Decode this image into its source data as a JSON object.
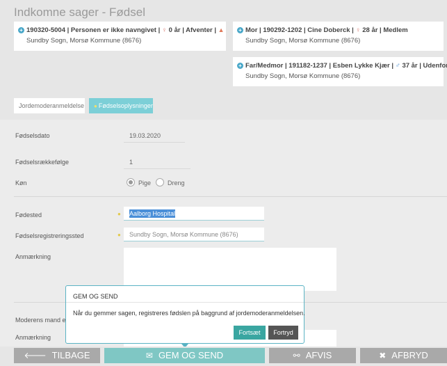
{
  "page_title": "Indkomne sager - Fødsel",
  "cards": {
    "child": {
      "line1": "190320-5004 | Personen er ikke navngivet | ",
      "age": "0 år",
      "status": " | Afventer | ",
      "location": "Sundby Sogn, Morsø Kommune (8676)"
    },
    "mother": {
      "line1": "Mor | 190292-1202 | Cine Doberck | ",
      "age": "28 år",
      "status": " | Medlem",
      "location": "Sundby Sogn, Morsø Kommune (8676)"
    },
    "father": {
      "line1": "Far/Medmor | 191182-1237 | Esben Lykke Kjær | ",
      "age": "37 år",
      "status": " | Udenfor",
      "location": "Sundby Sogn, Morsø Kommune (8676)"
    }
  },
  "tabs": {
    "midwife": "Jordemoderanmeldelse",
    "birth_info": "Fødselsoplysninger"
  },
  "form": {
    "birth_date_label": "Fødselsdato",
    "birth_date_value": "19.03.2020",
    "birth_order_label": "Fødselsrækkefølge",
    "birth_order_value": "1",
    "gender_label": "Køn",
    "gender_options": [
      "Pige",
      "Dreng"
    ],
    "gender_selected": "Pige",
    "birthplace_label": "Fødested",
    "birthplace_value": "Aalborg Hospital",
    "registration_place_label": "Fødselsregistreringssted",
    "registration_place_placeholder": "Sundby Sogn, Morsø Kommune (8676)",
    "remark_label": "Anmærkning",
    "mothers_husband_label": "Moderens mand e",
    "remark2_label": "Anmærkning"
  },
  "dialog": {
    "title": "GEM OG SEND",
    "message": "Når du gemmer sagen, registreres fødslen på baggrund af jordemoderanmeldelsen.",
    "continue_label": "Fortsæt",
    "cancel_label": "Fortryd"
  },
  "footer": {
    "back_label": "TILBAGE",
    "save_send_label": "GEM OG SEND",
    "reject_label": "AFVIS",
    "cancel_label": "AFBRYD"
  },
  "icons": {
    "back": "arrow-left-icon",
    "save": "envelope-icon",
    "reject": "broken-link-icon",
    "cancel": "close-icon"
  },
  "colors": {
    "accent": "#7fc7c4",
    "active_tab": "#7ccfd7",
    "continue_button": "#3aa6a1",
    "dialog_border": "#5ab3c4"
  }
}
